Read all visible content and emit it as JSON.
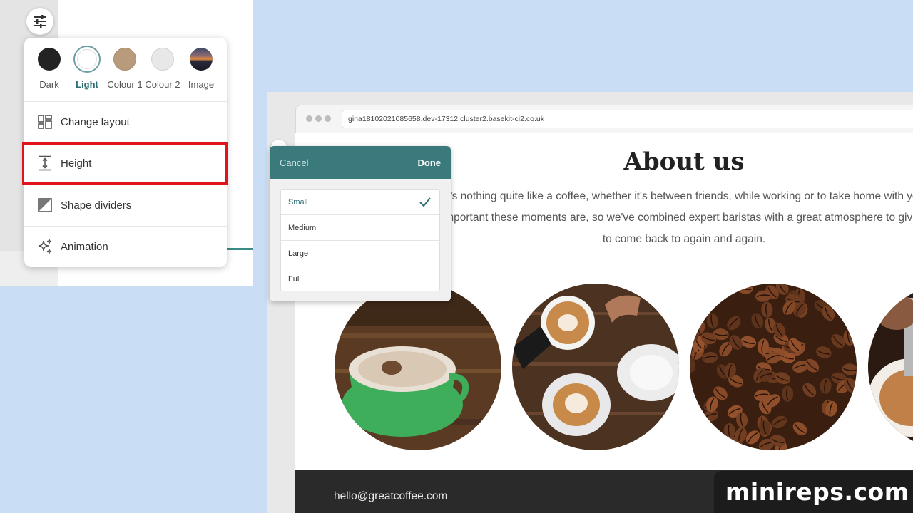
{
  "colors": {
    "accent": "#3b7a7c",
    "highlight": "#e0141b",
    "background": "#c9ddf5"
  },
  "theme_menu": {
    "swatches": [
      {
        "label": "Dark",
        "color": "#232323"
      },
      {
        "label": "Light",
        "color": "#ffffff",
        "selected": true
      },
      {
        "label": "Colour 1",
        "color": "#b89b7a"
      },
      {
        "label": "Colour 2",
        "color": "#e8e8e8"
      },
      {
        "label": "Image",
        "icon": "sunset-image"
      }
    ],
    "items": [
      {
        "label": "Change layout",
        "icon": "layout-icon"
      },
      {
        "label": "Height",
        "icon": "height-icon",
        "highlighted": true
      },
      {
        "label": "Shape dividers",
        "icon": "shape-dividers-icon"
      },
      {
        "label": "Animation",
        "icon": "sparkle-icon"
      }
    ]
  },
  "browser": {
    "url": "gina18102021085658.dev-17312.cluster2.basekit-ci2.co.uk"
  },
  "page": {
    "title": "About us",
    "paragraph_lines": [
      "There's nothing quite like a coffee, whether it's between friends, while working or to take home with you. We",
      "know how important these moments are, so we've combined expert baristas with a great atmosphere to give you a place",
      "to come back to again and again."
    ],
    "footer_email": "hello@greatcoffee.com"
  },
  "height_picker": {
    "cancel_label": "Cancel",
    "done_label": "Done",
    "options": [
      "Small",
      "Medium",
      "Large",
      "Full"
    ],
    "selected": "Small"
  },
  "watermark": "minireps.com"
}
